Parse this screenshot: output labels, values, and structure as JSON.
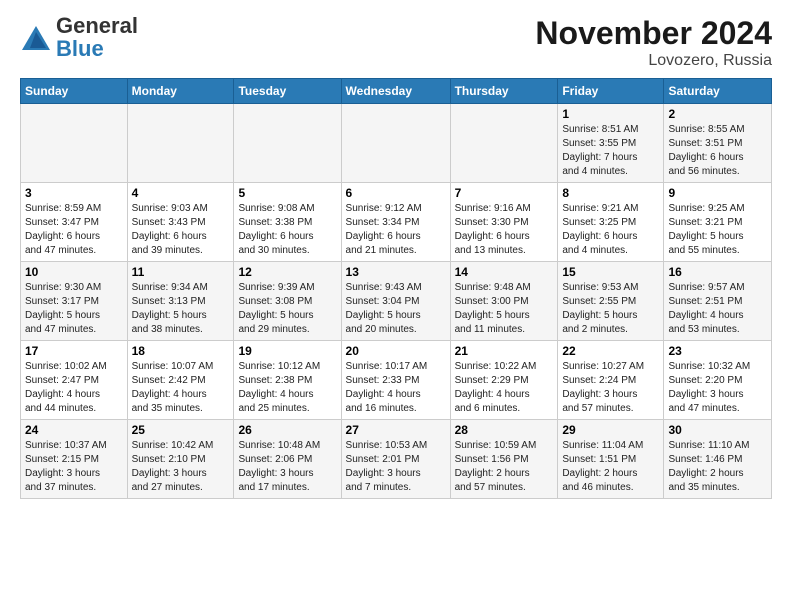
{
  "logo": {
    "general": "General",
    "blue": "Blue"
  },
  "title": "November 2024",
  "subtitle": "Lovozero, Russia",
  "headers": [
    "Sunday",
    "Monday",
    "Tuesday",
    "Wednesday",
    "Thursday",
    "Friday",
    "Saturday"
  ],
  "weeks": [
    [
      {
        "day": "",
        "detail": ""
      },
      {
        "day": "",
        "detail": ""
      },
      {
        "day": "",
        "detail": ""
      },
      {
        "day": "",
        "detail": ""
      },
      {
        "day": "",
        "detail": ""
      },
      {
        "day": "1",
        "detail": "Sunrise: 8:51 AM\nSunset: 3:55 PM\nDaylight: 7 hours\nand 4 minutes."
      },
      {
        "day": "2",
        "detail": "Sunrise: 8:55 AM\nSunset: 3:51 PM\nDaylight: 6 hours\nand 56 minutes."
      }
    ],
    [
      {
        "day": "3",
        "detail": "Sunrise: 8:59 AM\nSunset: 3:47 PM\nDaylight: 6 hours\nand 47 minutes."
      },
      {
        "day": "4",
        "detail": "Sunrise: 9:03 AM\nSunset: 3:43 PM\nDaylight: 6 hours\nand 39 minutes."
      },
      {
        "day": "5",
        "detail": "Sunrise: 9:08 AM\nSunset: 3:38 PM\nDaylight: 6 hours\nand 30 minutes."
      },
      {
        "day": "6",
        "detail": "Sunrise: 9:12 AM\nSunset: 3:34 PM\nDaylight: 6 hours\nand 21 minutes."
      },
      {
        "day": "7",
        "detail": "Sunrise: 9:16 AM\nSunset: 3:30 PM\nDaylight: 6 hours\nand 13 minutes."
      },
      {
        "day": "8",
        "detail": "Sunrise: 9:21 AM\nSunset: 3:25 PM\nDaylight: 6 hours\nand 4 minutes."
      },
      {
        "day": "9",
        "detail": "Sunrise: 9:25 AM\nSunset: 3:21 PM\nDaylight: 5 hours\nand 55 minutes."
      }
    ],
    [
      {
        "day": "10",
        "detail": "Sunrise: 9:30 AM\nSunset: 3:17 PM\nDaylight: 5 hours\nand 47 minutes."
      },
      {
        "day": "11",
        "detail": "Sunrise: 9:34 AM\nSunset: 3:13 PM\nDaylight: 5 hours\nand 38 minutes."
      },
      {
        "day": "12",
        "detail": "Sunrise: 9:39 AM\nSunset: 3:08 PM\nDaylight: 5 hours\nand 29 minutes."
      },
      {
        "day": "13",
        "detail": "Sunrise: 9:43 AM\nSunset: 3:04 PM\nDaylight: 5 hours\nand 20 minutes."
      },
      {
        "day": "14",
        "detail": "Sunrise: 9:48 AM\nSunset: 3:00 PM\nDaylight: 5 hours\nand 11 minutes."
      },
      {
        "day": "15",
        "detail": "Sunrise: 9:53 AM\nSunset: 2:55 PM\nDaylight: 5 hours\nand 2 minutes."
      },
      {
        "day": "16",
        "detail": "Sunrise: 9:57 AM\nSunset: 2:51 PM\nDaylight: 4 hours\nand 53 minutes."
      }
    ],
    [
      {
        "day": "17",
        "detail": "Sunrise: 10:02 AM\nSunset: 2:47 PM\nDaylight: 4 hours\nand 44 minutes."
      },
      {
        "day": "18",
        "detail": "Sunrise: 10:07 AM\nSunset: 2:42 PM\nDaylight: 4 hours\nand 35 minutes."
      },
      {
        "day": "19",
        "detail": "Sunrise: 10:12 AM\nSunset: 2:38 PM\nDaylight: 4 hours\nand 25 minutes."
      },
      {
        "day": "20",
        "detail": "Sunrise: 10:17 AM\nSunset: 2:33 PM\nDaylight: 4 hours\nand 16 minutes."
      },
      {
        "day": "21",
        "detail": "Sunrise: 10:22 AM\nSunset: 2:29 PM\nDaylight: 4 hours\nand 6 minutes."
      },
      {
        "day": "22",
        "detail": "Sunrise: 10:27 AM\nSunset: 2:24 PM\nDaylight: 3 hours\nand 57 minutes."
      },
      {
        "day": "23",
        "detail": "Sunrise: 10:32 AM\nSunset: 2:20 PM\nDaylight: 3 hours\nand 47 minutes."
      }
    ],
    [
      {
        "day": "24",
        "detail": "Sunrise: 10:37 AM\nSunset: 2:15 PM\nDaylight: 3 hours\nand 37 minutes."
      },
      {
        "day": "25",
        "detail": "Sunrise: 10:42 AM\nSunset: 2:10 PM\nDaylight: 3 hours\nand 27 minutes."
      },
      {
        "day": "26",
        "detail": "Sunrise: 10:48 AM\nSunset: 2:06 PM\nDaylight: 3 hours\nand 17 minutes."
      },
      {
        "day": "27",
        "detail": "Sunrise: 10:53 AM\nSunset: 2:01 PM\nDaylight: 3 hours\nand 7 minutes."
      },
      {
        "day": "28",
        "detail": "Sunrise: 10:59 AM\nSunset: 1:56 PM\nDaylight: 2 hours\nand 57 minutes."
      },
      {
        "day": "29",
        "detail": "Sunrise: 11:04 AM\nSunset: 1:51 PM\nDaylight: 2 hours\nand 46 minutes."
      },
      {
        "day": "30",
        "detail": "Sunrise: 11:10 AM\nSunset: 1:46 PM\nDaylight: 2 hours\nand 35 minutes."
      }
    ]
  ]
}
